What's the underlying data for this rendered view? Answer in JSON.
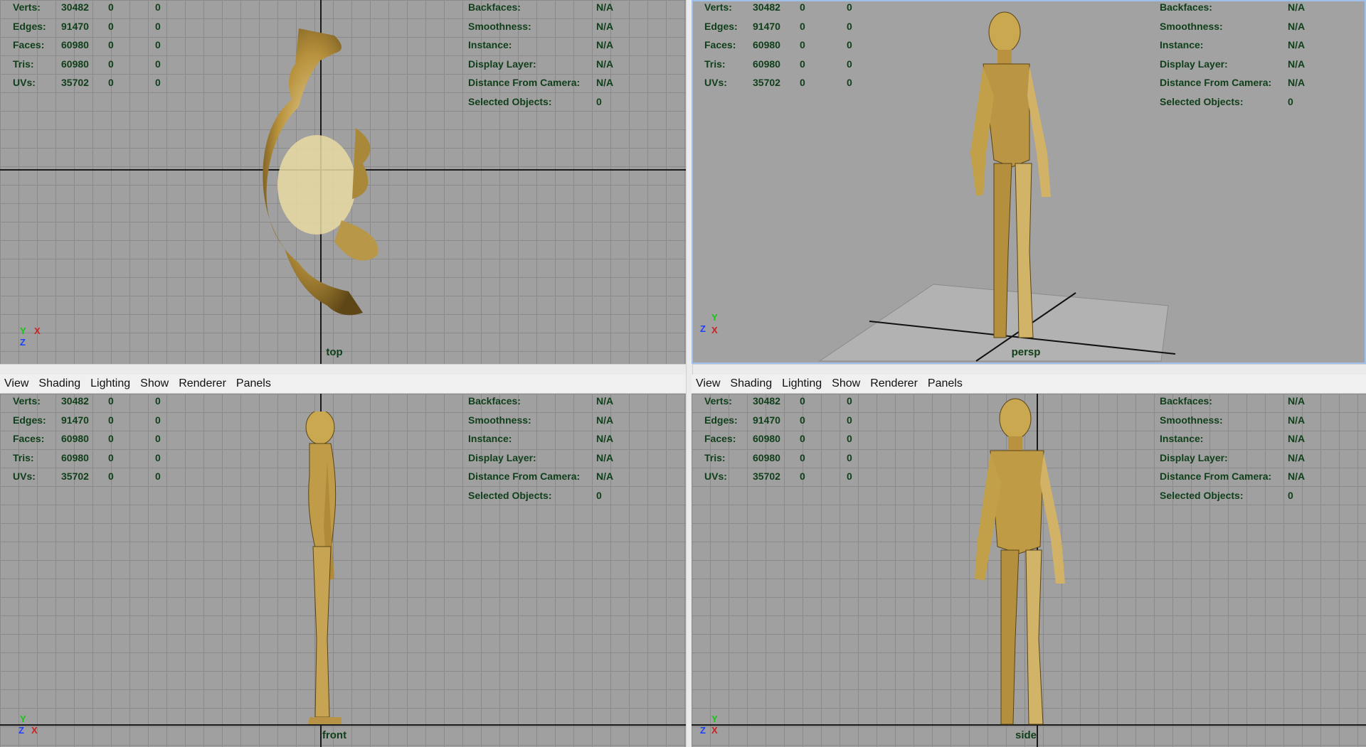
{
  "menu": [
    "View",
    "Shading",
    "Lighting",
    "Show",
    "Renderer",
    "Panels"
  ],
  "stats": {
    "rows": [
      {
        "label": "Verts:",
        "v1": "30482",
        "v2": "0",
        "v3": "0"
      },
      {
        "label": "Edges:",
        "v1": "91470",
        "v2": "0",
        "v3": "0"
      },
      {
        "label": "Faces:",
        "v1": "60980",
        "v2": "0",
        "v3": "0"
      },
      {
        "label": "Tris:",
        "v1": "60980",
        "v2": "0",
        "v3": "0"
      },
      {
        "label": "UVs:",
        "v1": "35702",
        "v2": "0",
        "v3": "0"
      }
    ],
    "right": [
      {
        "label": "Backfaces:",
        "value": "N/A"
      },
      {
        "label": "Smoothness:",
        "value": "N/A"
      },
      {
        "label": "Instance:",
        "value": "N/A"
      },
      {
        "label": "Display Layer:",
        "value": "N/A"
      },
      {
        "label": "Distance From Camera:",
        "value": "N/A"
      },
      {
        "label": "Selected Objects:",
        "value": "0"
      }
    ]
  },
  "panes": {
    "top": {
      "camera": "top"
    },
    "persp": {
      "camera": "persp"
    },
    "front": {
      "camera": "front"
    },
    "side": {
      "camera": "side"
    }
  },
  "gizmo_letters": {
    "x": "X",
    "y": "Y",
    "z": "Z"
  },
  "colors": {
    "hud_text": "#0f3f19",
    "viewport_bg": "#a0a0a0",
    "grid_line": "#8a8a8a",
    "axis_x": "#d02020",
    "axis_y": "#11c811",
    "axis_z": "#2040ff",
    "model": "#c9a850"
  }
}
